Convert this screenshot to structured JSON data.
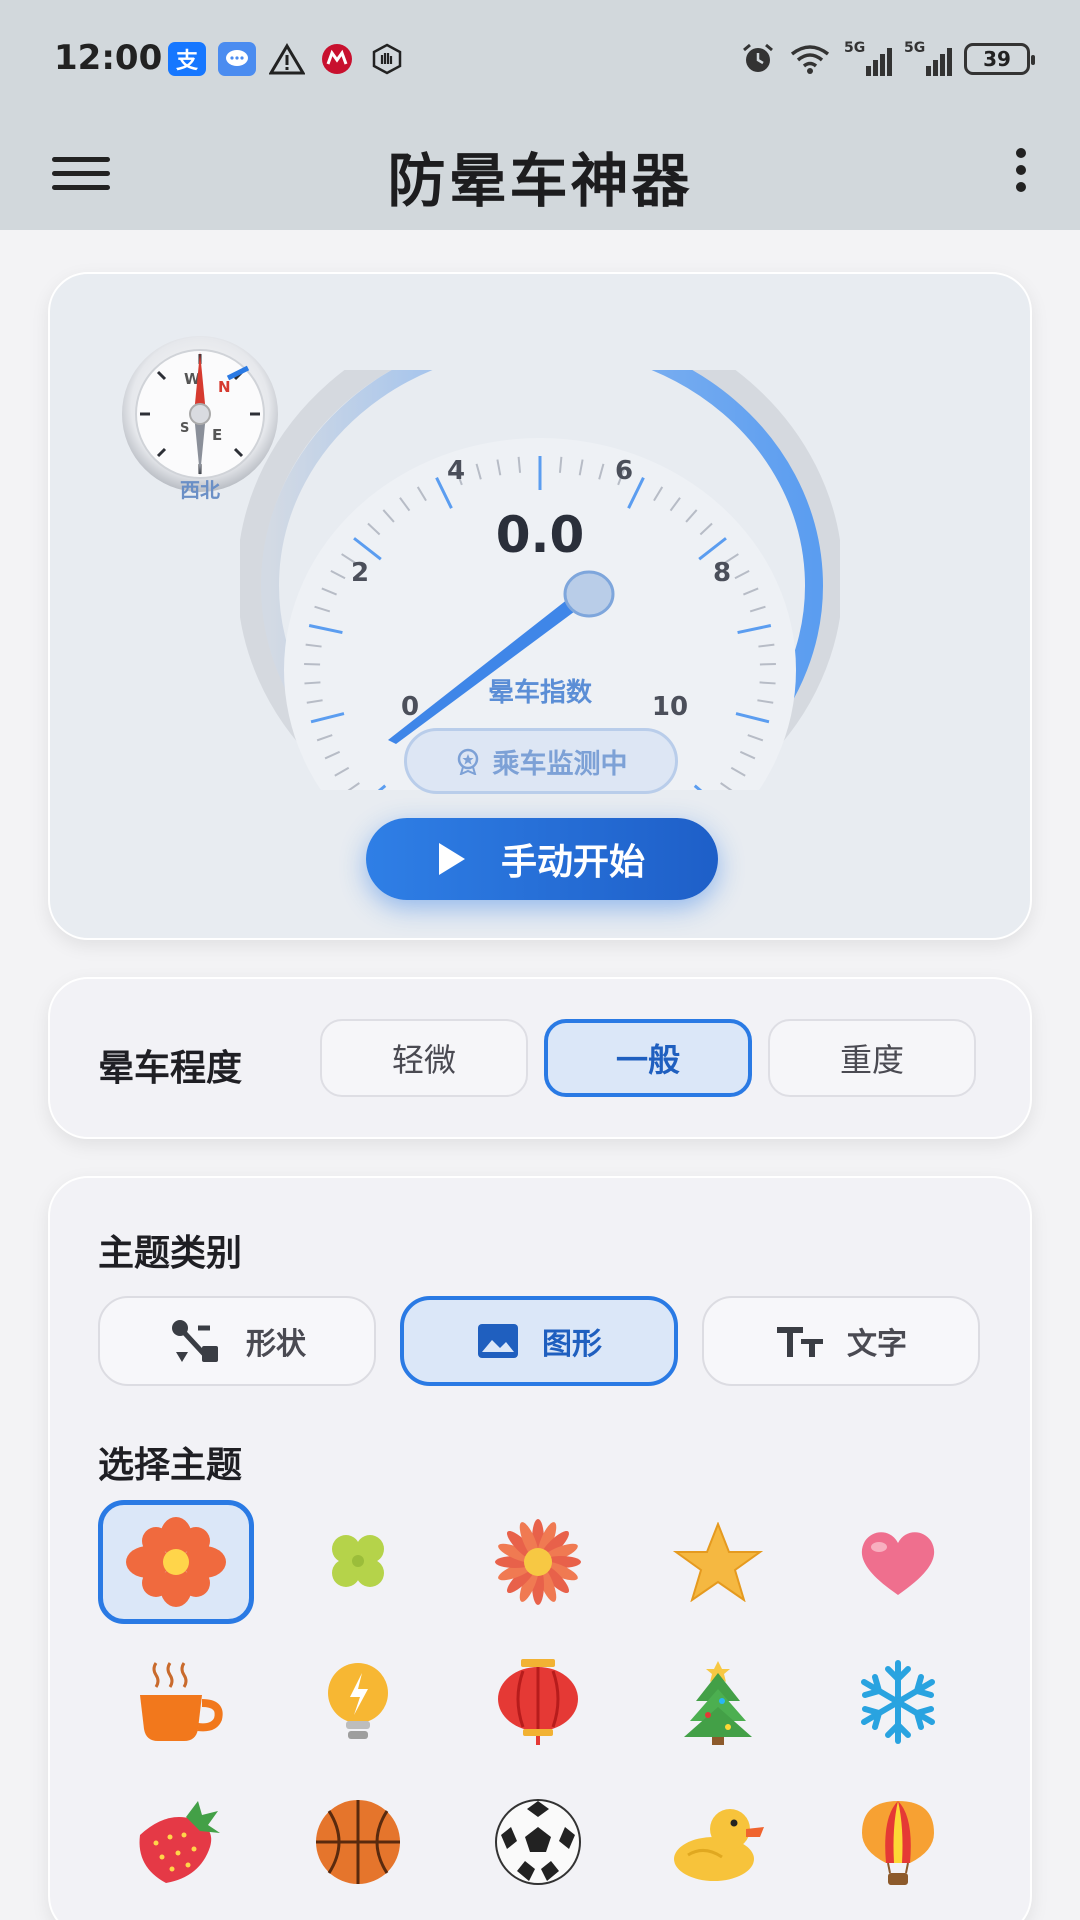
{
  "status": {
    "time": "12:00",
    "left_icons": [
      "alipay-icon",
      "message-icon",
      "warning-icon",
      "bank-icon",
      "hand-icon"
    ],
    "right_icons": [
      "alarm-icon",
      "wifi-icon",
      "signal-5g-icon",
      "signal-5g-icon"
    ],
    "network1": "5G",
    "network2": "5G",
    "battery": "39"
  },
  "appbar": {
    "title": "防晕车神器"
  },
  "gauge": {
    "compass_direction": "西北",
    "compass_letters": {
      "n": "N",
      "s": "S",
      "e": "E",
      "w": "W"
    },
    "value": "0.0",
    "value_numeric": 0.0,
    "label": "晕车指数",
    "ticks": [
      "0",
      "2",
      "4",
      "6",
      "8",
      "10"
    ],
    "monitor_text": "乘车监测中",
    "start_label": "手动开始",
    "accent": "#2a7ae4"
  },
  "level": {
    "title": "晕车程度",
    "options": [
      "轻微",
      "一般",
      "重度"
    ],
    "selected": "一般"
  },
  "theme": {
    "category_title": "主题类别",
    "categories": [
      "形状",
      "图形",
      "文字"
    ],
    "selected_category": "图形",
    "choose_title": "选择主题",
    "items": [
      "flower",
      "clover",
      "daisy",
      "star",
      "heart",
      "coffee",
      "bulb",
      "lantern",
      "tree",
      "snowflake",
      "strawberry",
      "basketball",
      "soccer",
      "duck",
      "balloon"
    ],
    "selected_item": "flower"
  }
}
